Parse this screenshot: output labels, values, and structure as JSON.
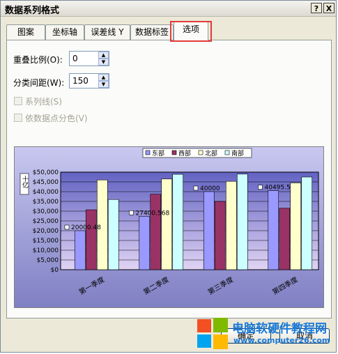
{
  "window": {
    "title": "数据系列格式",
    "help": "?",
    "close": "X"
  },
  "tabs": [
    "图案",
    "坐标轴",
    "误差线 Y",
    "数据标签",
    "选项"
  ],
  "options": {
    "overlap_label": "重叠比例(O):",
    "overlap_value": "0",
    "gap_label": "分类间距(W):",
    "gap_value": "150",
    "series_lines": "系列线(S)",
    "vary_colors": "依数据点分色(V)"
  },
  "chart_data": {
    "type": "bar",
    "categories": [
      "第一季度",
      "第二季度",
      "第三季度",
      "第四季度"
    ],
    "series": [
      {
        "name": "东部",
        "values": [
          20000,
          27400,
          40000,
          40495
        ],
        "color": "#9999ff"
      },
      {
        "name": "西部",
        "values": [
          30700,
          38700,
          35000,
          31500
        ],
        "color": "#993366"
      },
      {
        "name": "北部",
        "values": [
          46000,
          46500,
          45300,
          44500
        ],
        "color": "#ffffcc"
      },
      {
        "name": "南部",
        "values": [
          36000,
          48900,
          49000,
          47500
        ],
        "color": "#ccffff"
      }
    ],
    "yticks": [
      "$0",
      "$5,000",
      "$10,000",
      "$15,000",
      "$20,000",
      "$25,000",
      "$30,000",
      "$35,000",
      "$40,000",
      "$45,000",
      "$50,000"
    ],
    "ylim": [
      0,
      50000
    ],
    "ylabel": "十亿",
    "data_labels": [
      "20000.48",
      "27400.568",
      "40000",
      "40495.5"
    ],
    "legend_position": "top",
    "grid": true
  },
  "buttons": {
    "ok": "确定",
    "cancel": "取消"
  },
  "watermark": {
    "brand": "电脑软硬件教程网",
    "url": "www.computer26.com"
  }
}
